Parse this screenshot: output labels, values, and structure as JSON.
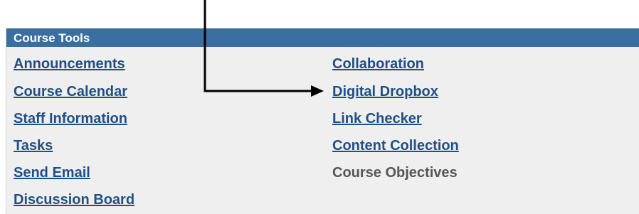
{
  "panel": {
    "title": "Course Tools"
  },
  "left_column": [
    "Announcements",
    "Course Calendar",
    "Staff Information",
    "Tasks",
    "Send Email",
    "Discussion Board"
  ],
  "right_column": [
    "Collaboration",
    "Digital Dropbox",
    "Link Checker",
    "Content Collection"
  ],
  "right_column_disabled": "Course Objectives",
  "colors": {
    "header_bg": "#3a6ea1",
    "link": "#1f4f86",
    "disabled_text": "#555555",
    "panel_bg": "#efefef",
    "arrow": "#000000"
  },
  "annotation": {
    "arrow_points_to": "Digital Dropbox"
  }
}
